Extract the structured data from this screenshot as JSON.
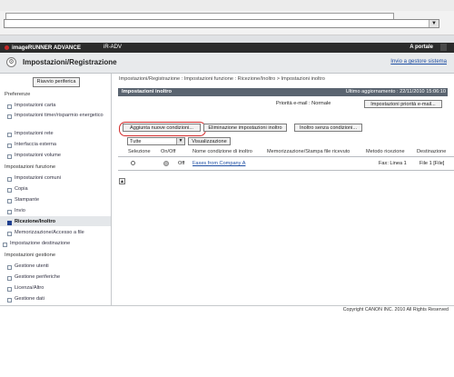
{
  "app": {
    "brand": "imageRUNNER ADVANCE",
    "device": "iR-ADV",
    "portal_link": "A portale",
    "page_title": "Impostazioni/Registrazione",
    "back_link": "Invio a gestore sistema"
  },
  "sidebar": {
    "restart_button": "Riavvio periferica",
    "sections": [
      {
        "title": "Preferenze",
        "items": [
          {
            "label": "Impostazioni carta"
          },
          {
            "label": "Impostazioni timer/risparmio energetico"
          },
          {
            "label": "Impostazioni rete"
          },
          {
            "label": "Interfaccia esterna"
          },
          {
            "label": "Impostazioni volume"
          }
        ]
      },
      {
        "title": "Impostazioni funzione",
        "items": [
          {
            "label": "Impostazioni comuni"
          },
          {
            "label": "Copia"
          },
          {
            "label": "Stampante"
          },
          {
            "label": "Invio"
          },
          {
            "label": "Ricezione/Inoltro"
          },
          {
            "label": "Memorizzazione/Accesso a file"
          }
        ]
      },
      {
        "title": "Impostazione destinazione",
        "items": []
      },
      {
        "title": "Impostazioni gestione",
        "items": [
          {
            "label": "Gestione utenti"
          },
          {
            "label": "Gestione periferiche"
          },
          {
            "label": "Licenza/Altro"
          },
          {
            "label": "Gestione dati"
          }
        ]
      }
    ],
    "active_item": "Ricezione/Inoltro"
  },
  "main": {
    "breadcrumb": "Impostazioni/Registrazione : Impostazioni funzione : Ricezione/Inoltro > Impostazioni inoltro",
    "section_title": "Impostazioni inoltro",
    "last_update": "Ultimo aggiornamento : 22/11/2010 15:06:10",
    "priority_label": "Priorità e-mail : Normale",
    "priority_button": "Impostazioni priorità e-mail...",
    "buttons": {
      "add": "Aggiunta nuove condizioni...",
      "delete": "Eliminazione impostazioni inoltro",
      "no_condition": "Inoltro senza condizioni..."
    },
    "filter_value": "Tutte",
    "view_button": "Visualizzazione",
    "table": {
      "headers": [
        "Selezione",
        "On/Off",
        "Nome condizione di inoltro",
        "Memorizzazione/Stampa file ricevuto",
        "Metodo ricezione",
        "Destinazione"
      ],
      "rows": [
        {
          "state": "Off",
          "name": "Faxes from Company A",
          "memo": "",
          "method": "Fax: Linea 1",
          "dest": "File 1 [File]"
        }
      ]
    }
  },
  "footer": {
    "copyright": "Copyright CANON INC. 2010 All Rights Reserved"
  }
}
